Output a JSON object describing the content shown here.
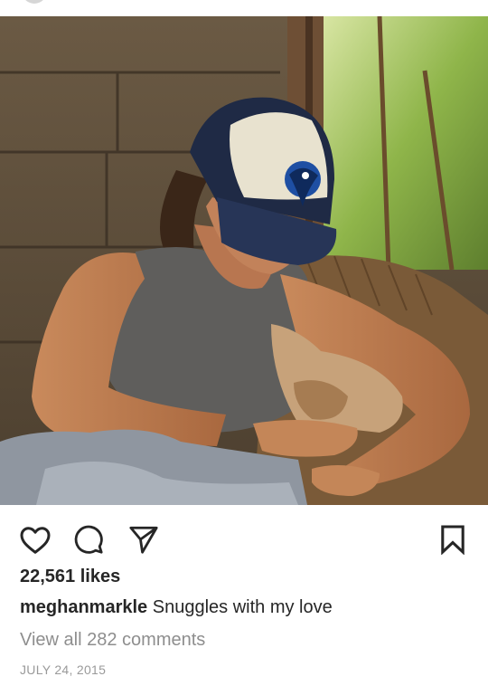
{
  "post": {
    "likes_text": "22,561 likes",
    "username": "meghanmarkle",
    "caption": "Snuggles with my love",
    "view_comments": "View all 282 comments",
    "date": "JULY 24, 2015"
  },
  "icons": {
    "like": "heart-outline-icon",
    "comment": "speech-bubble-icon",
    "share": "paper-plane-icon",
    "save": "bookmark-outline-icon"
  },
  "colors": {
    "text": "#262626",
    "muted": "#8e8e8e",
    "date": "#9a9a9a"
  }
}
